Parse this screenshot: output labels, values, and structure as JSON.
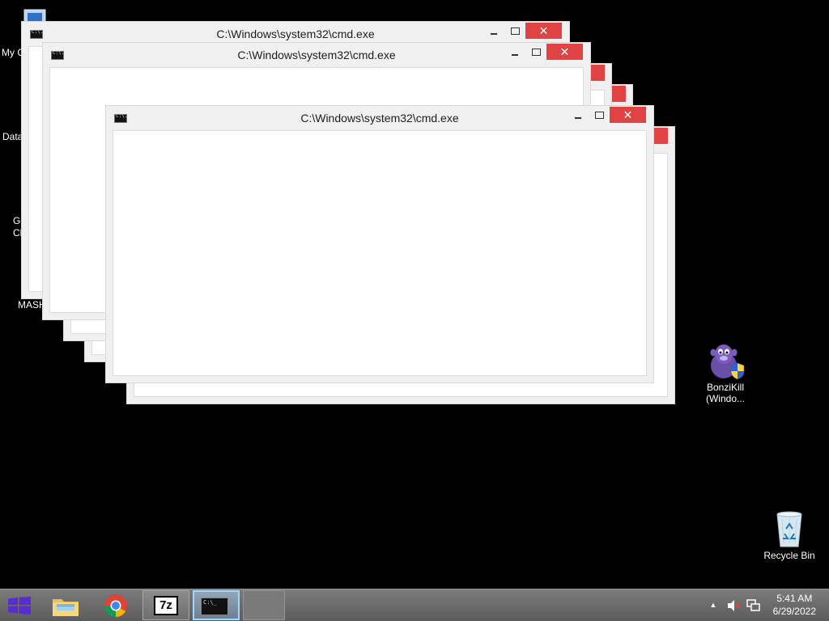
{
  "desktop": {
    "icons": {
      "my_computer": "My Computer",
      "data": "Data",
      "chrome_line1": "Google",
      "chrome_line2": "Chrome",
      "mash": "MASH",
      "bonzikill_line1": "BonziKill",
      "bonzikill_line2": "(Windo...",
      "recycle_bin": "Recycle Bin"
    }
  },
  "windows": {
    "title": "C:\\Windows\\system32\\cmd.exe",
    "close_glyph": "✕"
  },
  "taskbar": {
    "pinned": [
      "File Explorer",
      "Google Chrome",
      "7-Zip",
      "Command Prompt"
    ],
    "seven_zip_text": "7z",
    "cmd_text": "C:\\_",
    "tray": {
      "show_hidden_glyph": "▲",
      "time": "5:41 AM",
      "date": "6/29/2022"
    }
  },
  "colors": {
    "desktop_bg": "#000000",
    "close_button": "#e04343",
    "start_logo": "#5a2cd0",
    "taskbar": "#6b6b6b"
  }
}
